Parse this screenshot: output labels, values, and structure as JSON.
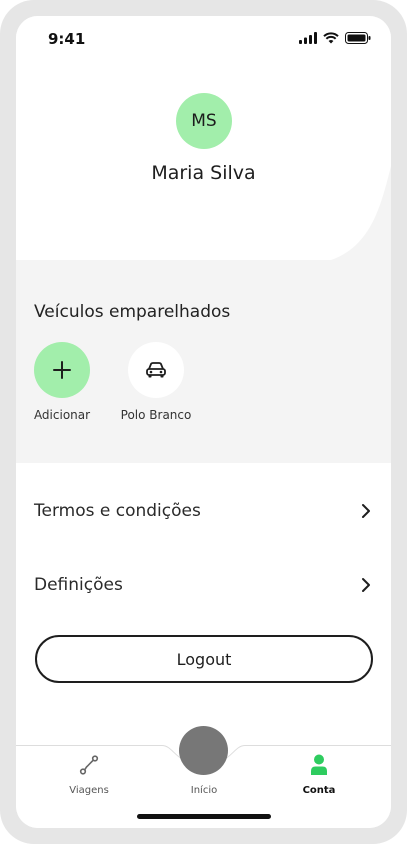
{
  "status_bar": {
    "time": "9:41"
  },
  "profile": {
    "initials": "MS",
    "name": "Maria Silva"
  },
  "vehicles": {
    "title": "Veículos emparelhados",
    "add_label": "Adicionar",
    "items": [
      {
        "label": "Polo Branco",
        "icon": "car-icon"
      }
    ]
  },
  "menu": [
    {
      "label": "Termos e condições",
      "icon": "chevron-right-icon"
    },
    {
      "label": "Definições",
      "icon": "chevron-right-icon"
    }
  ],
  "logout_label": "Logout",
  "nav": {
    "items": [
      {
        "label": "Viagens",
        "icon": "route-icon",
        "active": false
      },
      {
        "label": "Início",
        "icon": "home-icon",
        "active": false
      },
      {
        "label": "Conta",
        "icon": "person-icon",
        "active": true
      }
    ]
  },
  "colors": {
    "accent": "#a2eeab",
    "active_nav": "#2ecc5f",
    "section_bg": "#f4f4f4"
  }
}
